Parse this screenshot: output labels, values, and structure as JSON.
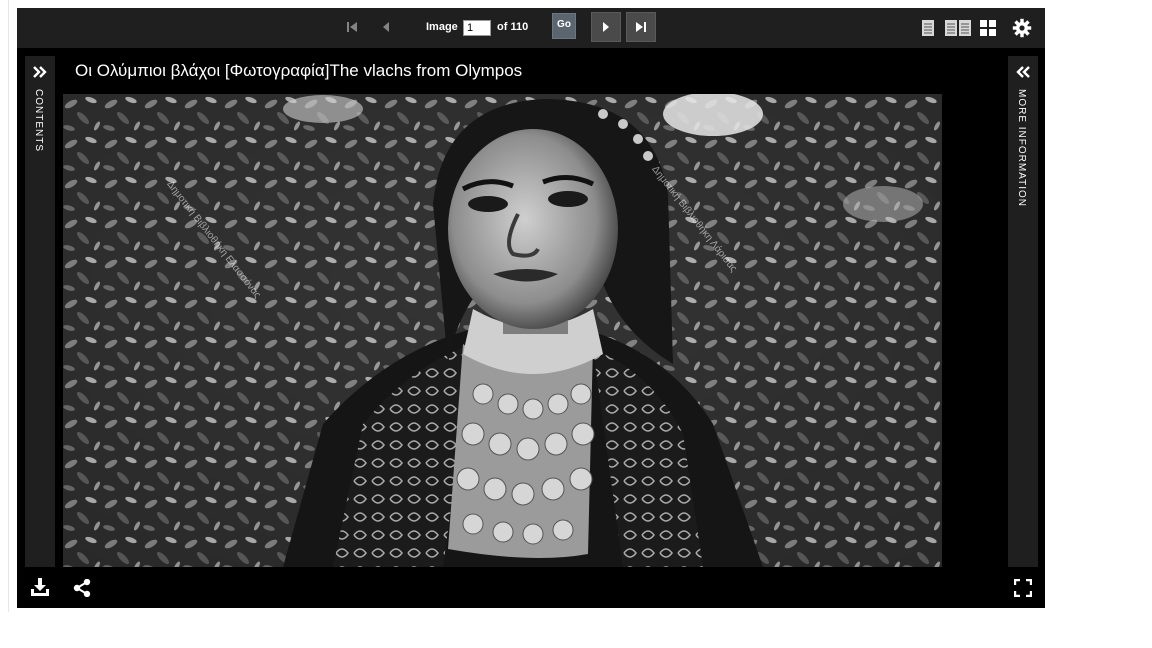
{
  "toolbar": {
    "image_label": "Image",
    "current_image": "1",
    "of_label": "of 110",
    "go_label": "Go",
    "icons": [
      "first-page-icon",
      "previous-page-icon",
      "next-page-icon",
      "last-page-icon",
      "single-page-view-icon",
      "two-page-view-icon",
      "thumbnail-grid-icon",
      "settings-gear-icon"
    ]
  },
  "left_panel": {
    "label": "CONTENTS",
    "icon": "expand-double-chevron-right-icon"
  },
  "right_panel": {
    "label": "MORE INFORMATION",
    "icon": "expand-double-chevron-left-icon"
  },
  "document": {
    "title": "Οι Ολύμπιοι βλάχοι [Φωτογραφία]The vlachs from Olympos",
    "image_description_watermark_left": "Δημοτική Βιβλιοθήκη Ελασσόνας",
    "image_description_watermark_right": "Δημοτική Βιβλιοθήκη Λάρισας"
  },
  "bottombar": {
    "icons": [
      "download-icon",
      "share-icon",
      "fullscreen-icon"
    ]
  },
  "colors": {
    "toolbar_bg": "#1f1f1f",
    "viewer_bg": "#000000",
    "go_button": "#5b6570"
  }
}
